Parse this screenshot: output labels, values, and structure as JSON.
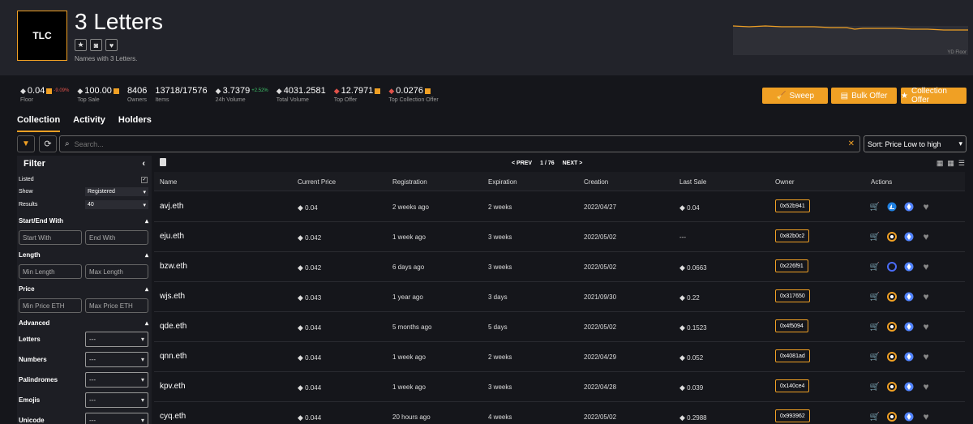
{
  "collection": {
    "logo_text": "TLC",
    "title": "3 Letters",
    "description": "Names with 3 Letters.",
    "floor_chart_label": "YD Floor"
  },
  "stats": [
    {
      "value": "0.04",
      "label": "Floor",
      "change": "-9.09%",
      "icon": "eth-icon"
    },
    {
      "value": "100.00",
      "label": "Top Sale",
      "icon": "eth-icon"
    },
    {
      "value": "8406",
      "label": "Owners"
    },
    {
      "value": "13718/17576",
      "label": "Items"
    },
    {
      "value": "3.7379",
      "label": "24h Volume",
      "change": "+2.52%",
      "icon": "eth-icon"
    },
    {
      "value": "4031.2581",
      "label": "Total Volume",
      "icon": "eth-icon"
    },
    {
      "value": "12.7971",
      "label": "Top Offer",
      "icon": "weth-icon"
    },
    {
      "value": "0.0276",
      "label": "Top Collection Offer",
      "icon": "weth-icon"
    }
  ],
  "actions": {
    "sweep": "Sweep",
    "bulk_offer": "Bulk Offer",
    "collection_offer": "Collection Offer"
  },
  "tabs": [
    "Collection",
    "Activity",
    "Holders"
  ],
  "search": {
    "placeholder": "Search..."
  },
  "sort": {
    "selected": "Sort: Price Low to high"
  },
  "filter": {
    "title": "Filter",
    "listed_label": "Listed",
    "listed_checked": "✓",
    "show_label": "Show",
    "show_value": "Registered",
    "results_label": "Results",
    "results_value": "40",
    "start_end": "Start/End With",
    "start_with": "Start With",
    "end_with": "End With",
    "length": "Length",
    "min_length": "Min Length",
    "max_length": "Max Length",
    "price": "Price",
    "min_price": "Min Price ETH",
    "max_price": "Max Price ETH",
    "advanced": "Advanced",
    "letters": "Letters",
    "numbers": "Numbers",
    "palindromes": "Palindromes",
    "emojis": "Emojis",
    "unicode": "Unicode",
    "dd_value": "---"
  },
  "pager": {
    "prev": "< PREV",
    "page": "1 / 76",
    "next": "NEXT >"
  },
  "columns": [
    "Name",
    "Current Price",
    "Registration",
    "Expiration",
    "Creation",
    "Last Sale",
    "Owner",
    "Actions"
  ],
  "rows": [
    {
      "name": "avj.eth",
      "price": "0.04",
      "registration": "2 weeks ago",
      "expiration": "2 weeks",
      "creation": "2022/04/27",
      "last_sale": "0.04",
      "owner": "0x52b941",
      "market": "opensea"
    },
    {
      "name": "eju.eth",
      "price": "0.042",
      "registration": "1 week ago",
      "expiration": "3 weeks",
      "creation": "2022/05/02",
      "last_sale": "---",
      "owner": "0x82b0c2",
      "market": "looksrare"
    },
    {
      "name": "bzw.eth",
      "price": "0.042",
      "registration": "6 days ago",
      "expiration": "3 weeks",
      "creation": "2022/05/02",
      "last_sale": "0.0663",
      "owner": "0x226f91",
      "market": "x2y2"
    },
    {
      "name": "wjs.eth",
      "price": "0.043",
      "registration": "1 year ago",
      "expiration": "3 days",
      "creation": "2021/09/30",
      "last_sale": "0.22",
      "owner": "0x317650",
      "market": "looksrare"
    },
    {
      "name": "qde.eth",
      "price": "0.044",
      "registration": "5 months ago",
      "expiration": "5 days",
      "creation": "2022/05/02",
      "last_sale": "0.1523",
      "owner": "0x4f5094",
      "market": "looksrare"
    },
    {
      "name": "qnn.eth",
      "price": "0.044",
      "registration": "1 week ago",
      "expiration": "2 weeks",
      "creation": "2022/04/29",
      "last_sale": "0.052",
      "owner": "0x4081ad",
      "market": "looksrare"
    },
    {
      "name": "kpv.eth",
      "price": "0.044",
      "registration": "1 week ago",
      "expiration": "3 weeks",
      "creation": "2022/04/28",
      "last_sale": "0.039",
      "owner": "0x140ce4",
      "market": "looksrare"
    },
    {
      "name": "cyq.eth",
      "price": "0.044",
      "registration": "20 hours ago",
      "expiration": "4 weeks",
      "creation": "2022/05/02",
      "last_sale": "0.2988",
      "owner": "0x993962",
      "market": "looksrare"
    }
  ],
  "colors": {
    "accent": "#f0a024",
    "bg": "#15161b",
    "header": "#22232a",
    "negative": "#e0524a",
    "positive": "#3fc56b"
  }
}
